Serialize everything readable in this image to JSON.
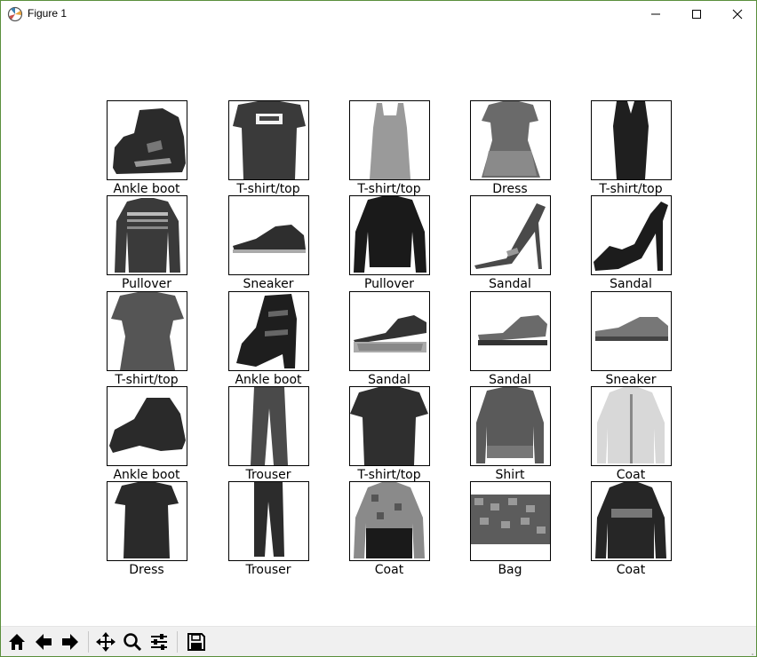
{
  "window": {
    "title": "Figure 1"
  },
  "figure": {
    "rows": [
      [
        "Ankle boot",
        "T-shirt/top",
        "T-shirt/top",
        "Dress",
        "T-shirt/top"
      ],
      [
        "Pullover",
        "Sneaker",
        "Pullover",
        "Sandal",
        "Sandal"
      ],
      [
        "T-shirt/top",
        "Ankle boot",
        "Sandal",
        "Sandal",
        "Sneaker"
      ],
      [
        "Ankle boot",
        "Trouser",
        "T-shirt/top",
        "Shirt",
        "Coat"
      ],
      [
        "Dress",
        "Trouser",
        "Coat",
        "Bag",
        "Coat"
      ]
    ]
  },
  "toolbar": {
    "tools": [
      "home-icon",
      "back-arrow-icon",
      "forward-arrow-icon",
      "pan-icon",
      "zoom-icon",
      "subplots-icon",
      "save-icon"
    ]
  }
}
